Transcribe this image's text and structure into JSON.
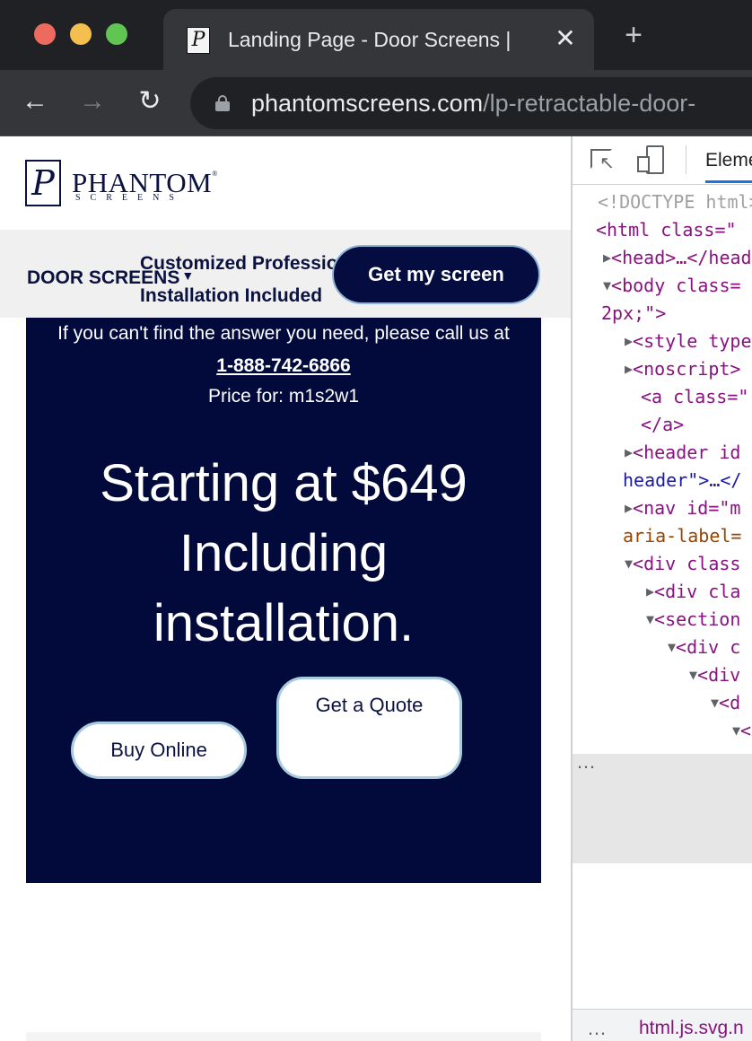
{
  "browser": {
    "tab": {
      "favicon_letter": "P",
      "title": "Landing Page - Door Screens |",
      "close_glyph": "✕"
    },
    "new_tab_glyph": "+",
    "nav": {
      "back": "←",
      "forward": "→",
      "reload": "↻"
    },
    "url": {
      "host": "phantomscreens.com",
      "path": "/lp-retractable-door-"
    }
  },
  "site": {
    "logo": {
      "mark": "P",
      "word": "PHANTOM",
      "reg": "®",
      "sub": "SCREENS"
    },
    "nav": {
      "menu_label": "DOOR SCREENS",
      "caret": "▼",
      "tagline_line1": "Customized Professional",
      "tagline_line2": "Installation Included",
      "cta": "Get my screen"
    },
    "hero": {
      "help_text": "If you can't find the answer you need, please call us at",
      "phone": "1-888-742-6866",
      "price_for": "Price for: m1s2w1",
      "headline_line1": "Starting at $649",
      "headline_line2": "Including",
      "headline_line3": "installation.",
      "buy_button": "Buy Online",
      "quote_button": "Get a Quote"
    }
  },
  "devtools": {
    "active_tab": "Elements",
    "dom_lines": [
      "<!DOCTYPE html>",
      "<html class=\"",
      "<head>…</head>",
      "<body class=",
      "2px;\">",
      "<style type",
      "<noscript>",
      "<a class=\"",
      "</a>",
      "<header id",
      "header\">…</",
      "<nav id=\"m",
      "aria-label=",
      "<div class",
      "<div cla",
      "<section",
      "<div c",
      "<div",
      "<d",
      "<"
    ],
    "ellipsis": "…",
    "footer_dots": "…",
    "breadcrumb": "html.js.svg.n"
  },
  "colors": {
    "brand_navy": "#010a3b",
    "button_border": "#a9cbe0",
    "chrome_dark": "#202124",
    "chrome_tab": "#35363a"
  }
}
